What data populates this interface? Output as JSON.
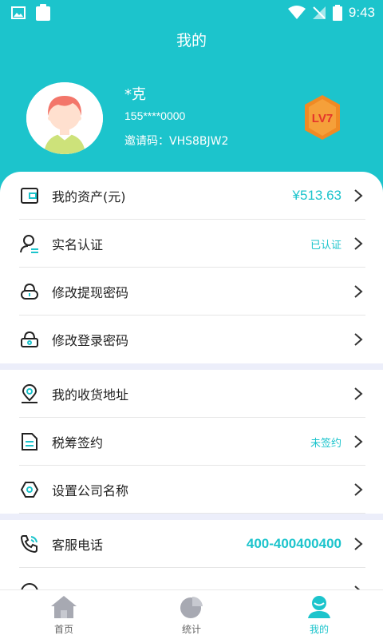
{
  "status_bar": {
    "time": "9:43"
  },
  "header": {
    "title": "我的"
  },
  "profile": {
    "name": "*克",
    "phone": "155****0000",
    "invite_code": "邀请码：VHS8BJW2",
    "level": "LV7"
  },
  "menu_group_1": [
    {
      "label": "我的资产(元)",
      "value": "¥513.63",
      "icon": "wallet-icon"
    },
    {
      "label": "实名认证",
      "value": "已认证",
      "icon": "user-verify-icon"
    },
    {
      "label": "修改提现密码",
      "value": "",
      "icon": "lock-icon"
    },
    {
      "label": "修改登录密码",
      "value": "",
      "icon": "lock-icon"
    }
  ],
  "menu_group_2": [
    {
      "label": "我的收货地址",
      "value": "",
      "icon": "location-icon"
    },
    {
      "label": "税筹签约",
      "value": "未签约",
      "icon": "document-icon"
    },
    {
      "label": "设置公司名称",
      "value": "",
      "icon": "hexagon-icon"
    }
  ],
  "menu_group_3": [
    {
      "label": "客服电话",
      "value": "400-400400400",
      "icon": "phone-icon"
    }
  ],
  "tabbar": [
    {
      "label": "首页",
      "icon": "home-icon",
      "active": false
    },
    {
      "label": "统计",
      "icon": "pie-chart-icon",
      "active": false
    },
    {
      "label": "我的",
      "icon": "profile-icon",
      "active": true
    }
  ],
  "colors": {
    "accent": "#1cc4cc",
    "badge": "#f08a24",
    "divider_band": "#eceefa"
  }
}
